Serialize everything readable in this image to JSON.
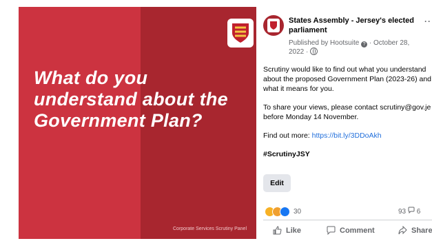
{
  "image": {
    "headline": "What do you understand about the Government Plan?",
    "footer": "Corporate Services Scrutiny Panel",
    "colors": {
      "primary": "#cc3340",
      "secondary": "#a8262f"
    }
  },
  "post": {
    "page_name": "States Assembly - Jersey's elected parliament",
    "published_by": "Published by Hootsuite",
    "date": "October 28, 2022",
    "paragraph1": "Scrutiny would like to find out what you understand about the proposed Government Plan (2023-26) and what it means for you.",
    "paragraph2": "To share your views, please contact scrutiny@gov.je before Monday 14 November.",
    "find_out_label": "Find out more: ",
    "link": "https://bit.ly/3DDoAkh",
    "hashtag": "#ScrutinyJSY",
    "edit_label": "Edit",
    "reaction_count": "30",
    "comment_count": "93",
    "share_count": "6",
    "actions": {
      "like": "Like",
      "comment": "Comment",
      "share": "Share"
    }
  }
}
